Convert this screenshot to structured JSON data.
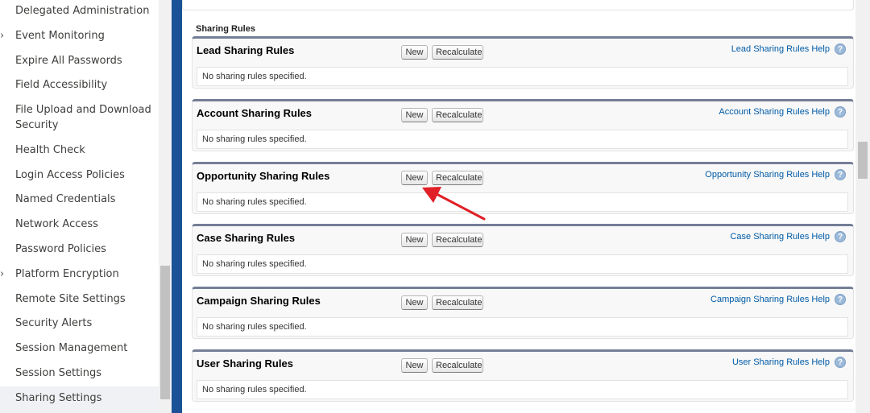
{
  "sidebar": {
    "items": [
      {
        "label": "Delegated Administration",
        "chevron": false,
        "active": false
      },
      {
        "label": "Event Monitoring",
        "chevron": true,
        "active": false
      },
      {
        "label": "Expire All Passwords",
        "chevron": false,
        "active": false
      },
      {
        "label": "Field Accessibility",
        "chevron": false,
        "active": false
      },
      {
        "label": "File Upload and Download Security",
        "chevron": false,
        "active": false
      },
      {
        "label": "Health Check",
        "chevron": false,
        "active": false
      },
      {
        "label": "Login Access Policies",
        "chevron": false,
        "active": false
      },
      {
        "label": "Named Credentials",
        "chevron": false,
        "active": false
      },
      {
        "label": "Network Access",
        "chevron": false,
        "active": false
      },
      {
        "label": "Password Policies",
        "chevron": false,
        "active": false
      },
      {
        "label": "Platform Encryption",
        "chevron": true,
        "active": false
      },
      {
        "label": "Remote Site Settings",
        "chevron": false,
        "active": false
      },
      {
        "label": "Security Alerts",
        "chevron": false,
        "active": false
      },
      {
        "label": "Session Management",
        "chevron": false,
        "active": false
      },
      {
        "label": "Session Settings",
        "chevron": false,
        "active": false
      },
      {
        "label": "Sharing Settings",
        "chevron": false,
        "active": true
      }
    ]
  },
  "main": {
    "section_title": "Sharing Rules",
    "new_label": "New",
    "recalc_label": "Recalculate",
    "help_glyph": "?",
    "blocks": [
      {
        "title": "Lead Sharing Rules",
        "help": "Lead Sharing Rules Help",
        "empty": "No sharing rules specified."
      },
      {
        "title": "Account Sharing Rules",
        "help": "Account Sharing Rules Help",
        "empty": "No sharing rules specified."
      },
      {
        "title": "Opportunity Sharing Rules",
        "help": "Opportunity Sharing Rules Help",
        "empty": "No sharing rules specified."
      },
      {
        "title": "Case Sharing Rules",
        "help": "Case Sharing Rules Help",
        "empty": "No sharing rules specified."
      },
      {
        "title": "Campaign Sharing Rules",
        "help": "Campaign Sharing Rules Help",
        "empty": "No sharing rules specified."
      },
      {
        "title": "User Sharing Rules",
        "help": "User Sharing Rules Help",
        "empty": "No sharing rules specified."
      }
    ]
  },
  "colors": {
    "accent_blue": "#1b5297",
    "link": "#015ba7",
    "annotation_arrow": "#e01f26"
  }
}
